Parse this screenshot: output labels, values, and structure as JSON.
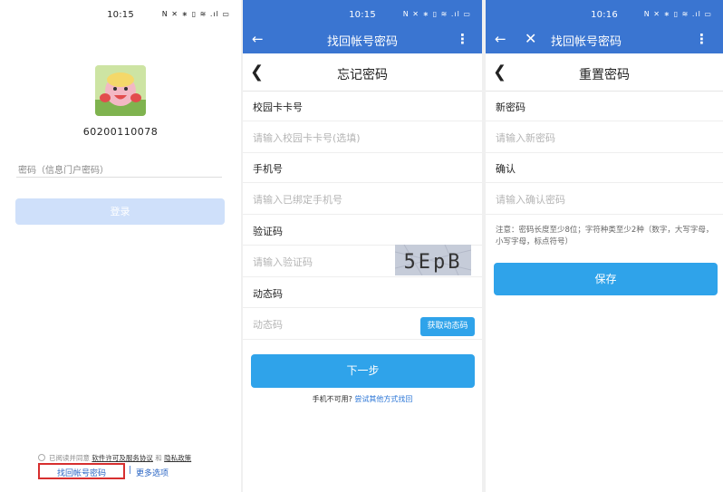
{
  "login": {
    "time": "10:15",
    "status_icons": "N ✕ ∗ ▯ ≋ .ıl ▭",
    "account_number": "60200110078",
    "password_placeholder": "密码（信息门户密码）",
    "login_button": "登录",
    "agree_prefix": "已阅读并同意",
    "agree_terms": "软件许可及服务协议",
    "agree_and": "和",
    "agree_privacy": "隐私政策",
    "forgot_link": "找回帐号密码",
    "separator": "|",
    "more_options": "更多选项"
  },
  "forgot": {
    "time": "10:15",
    "status_icons": "N ✕ ∗ ▯ ≋ .ıl ▭",
    "appbar_title": "找回帐号密码",
    "page_title": "忘记密码",
    "fields": [
      {
        "label": "校园卡卡号",
        "placeholder": "请输入校园卡卡号(选填)"
      },
      {
        "label": "手机号",
        "placeholder": "请输入已绑定手机号"
      },
      {
        "label": "验证码",
        "placeholder": "请输入验证码"
      },
      {
        "label": "动态码",
        "placeholder": "动态码"
      }
    ],
    "captcha_text": "5EpB",
    "get_code_button": "获取动态码",
    "next_button": "下一步",
    "phone_unavailable": "手机不可用?",
    "try_other": "尝试其他方式找回"
  },
  "reset": {
    "time": "10:16",
    "status_icons": "N ✕ ∗ ▯ ≋ .ıl ▭",
    "appbar_title": "找回帐号密码",
    "page_title": "重置密码",
    "fields": [
      {
        "label": "新密码",
        "placeholder": "请输入新密码"
      },
      {
        "label": "确认",
        "placeholder": "请输入确认密码"
      }
    ],
    "note": "注意：密码长度至少8位；字符种类至少2种（数字，大写字母，小写字母，标点符号）",
    "save_button": "保存"
  },
  "colors": {
    "primary": "#3a75d1",
    "button": "#2fa3ea",
    "highlight": "#d72f2f",
    "link": "#2a65c4"
  }
}
